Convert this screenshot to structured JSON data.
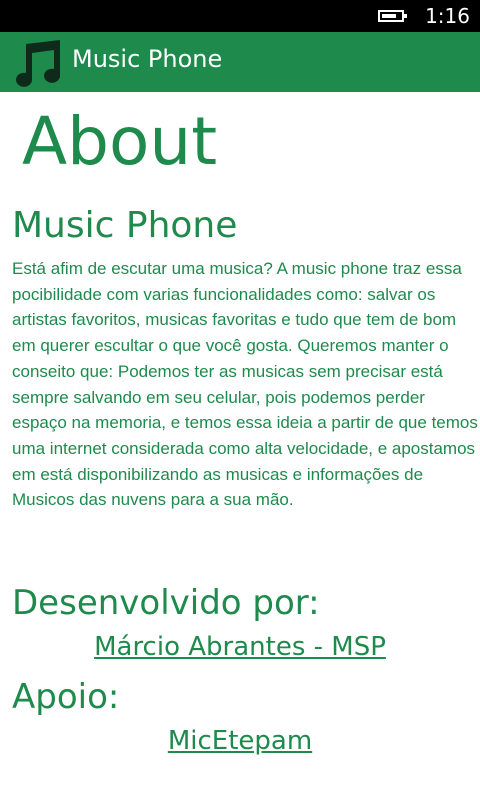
{
  "status_bar": {
    "time": "1:16",
    "battery_icon": "battery-icon"
  },
  "app_bar": {
    "title": "Music Phone",
    "icon": "music-note-icon",
    "background_color": "#1e8a4c"
  },
  "page": {
    "title": "About",
    "app_name": "Music Phone",
    "description": "Está afim de escutar uma musica? A music phone traz essa pocibilidade com varias funcionalidades como: salvar os artistas favoritos, musicas favoritas e tudo que tem de bom em querer escultar o que você gosta. Queremos manter o conseito que: Podemos ter as musicas sem precisar está sempre salvando em seu celular, pois podemos perder espaço na memoria, e temos essa ideia a partir de que temos uma internet considerada como alta velocidade, e apostamos em está disponibilizando as musicas e informações de Musicos das nuvens para a sua mão.",
    "developed_by_label": "Desenvolvido por:",
    "developer_link": "Márcio Abrantes - MSP",
    "support_label": "Apoio:",
    "support_link": "MicEtepam",
    "text_color": "#1e8a4c"
  }
}
